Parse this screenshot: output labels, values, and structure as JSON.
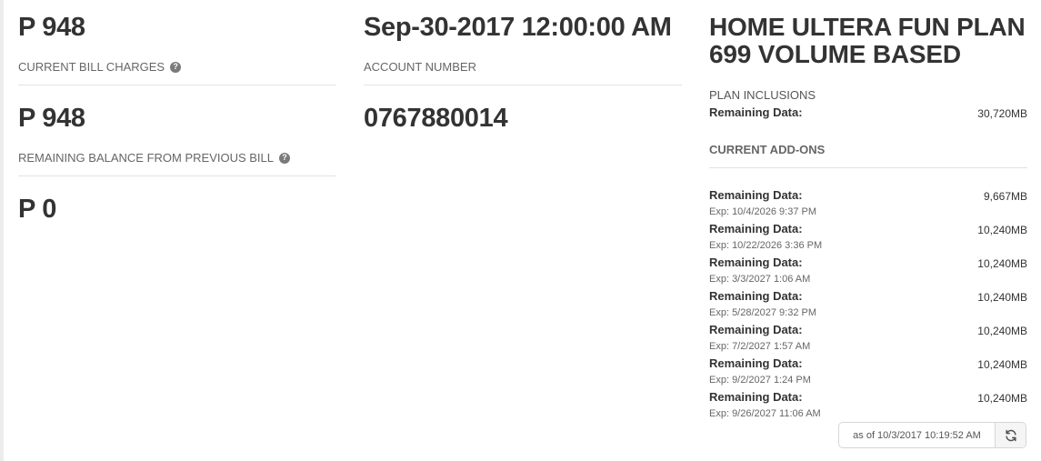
{
  "bill": {
    "current_amount": "P 948",
    "current_label": "CURRENT BILL CHARGES",
    "remaining_amount": "P 948",
    "remaining_label": "REMAINING BALANCE FROM PREVIOUS BILL",
    "previous_amount": "P 0"
  },
  "account": {
    "date": "Sep-30-2017 12:00:00 AM",
    "number_label": "ACCOUNT NUMBER",
    "number": "0767880014"
  },
  "plan": {
    "title": "HOME ULTERA FUN PLAN 699 VOLUME BASED",
    "inclusions_label": "PLAN INCLUSIONS",
    "inclusion": {
      "label": "Remaining Data:",
      "value": "30,720MB"
    },
    "addons_label": "CURRENT ADD-ONS",
    "addons": [
      {
        "label": "Remaining Data:",
        "value": "9,667MB",
        "exp": "Exp: 10/4/2026 9:37 PM"
      },
      {
        "label": "Remaining Data:",
        "value": "10,240MB",
        "exp": "Exp: 10/22/2026 3:36 PM"
      },
      {
        "label": "Remaining Data:",
        "value": "10,240MB",
        "exp": "Exp: 3/3/2027 1:06 AM"
      },
      {
        "label": "Remaining Data:",
        "value": "10,240MB",
        "exp": "Exp: 5/28/2027 9:32 PM"
      },
      {
        "label": "Remaining Data:",
        "value": "10,240MB",
        "exp": "Exp: 7/2/2027 1:57 AM"
      },
      {
        "label": "Remaining Data:",
        "value": "10,240MB",
        "exp": "Exp: 9/2/2027 1:24 PM"
      },
      {
        "label": "Remaining Data:",
        "value": "10,240MB",
        "exp": "Exp: 9/26/2027 11:06 AM"
      }
    ],
    "as_of": "as of 10/3/2017 10:19:52 AM"
  },
  "icons": {
    "help": "question-circle-icon",
    "refresh": "refresh-icon"
  }
}
